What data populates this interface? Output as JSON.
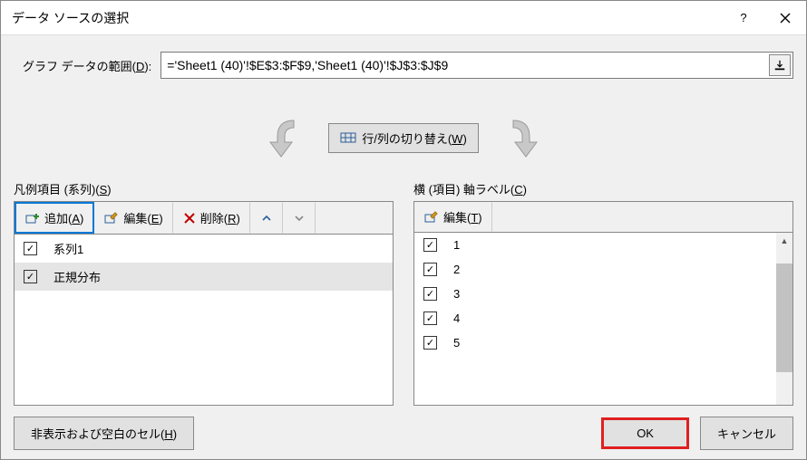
{
  "title": "データ ソースの選択",
  "range": {
    "label_pre": "グラフ データの範囲(",
    "label_key": "D",
    "label_post": "):",
    "value": "='Sheet1 (40)'!$E$3:$F$9,'Sheet1 (40)'!$J$3:$J$9"
  },
  "swap": {
    "label_pre": "行/列の切り替え(",
    "key": "W",
    "label_post": ")"
  },
  "legend": {
    "title_pre": "凡例項目 (系列)(",
    "key": "S",
    "title_post": ")",
    "add": {
      "pre": "追加(",
      "key": "A",
      "post": ")"
    },
    "edit": {
      "pre": "編集(",
      "key": "E",
      "post": ")"
    },
    "remove": {
      "pre": "削除(",
      "key": "R",
      "post": ")"
    },
    "items": [
      {
        "label": "系列1",
        "checked": true,
        "selected": false
      },
      {
        "label": "正規分布",
        "checked": true,
        "selected": true
      }
    ]
  },
  "axis": {
    "title_pre": "横 (項目) 軸ラベル(",
    "key": "C",
    "title_post": ")",
    "edit": {
      "pre": "編集(",
      "key": "T",
      "post": ")"
    },
    "items": [
      {
        "label": "1",
        "checked": true
      },
      {
        "label": "2",
        "checked": true
      },
      {
        "label": "3",
        "checked": true
      },
      {
        "label": "4",
        "checked": true
      },
      {
        "label": "5",
        "checked": true
      }
    ]
  },
  "footer": {
    "hidden": {
      "pre": "非表示および空白のセル(",
      "key": "H",
      "post": ")"
    },
    "ok": "OK",
    "cancel": "キャンセル"
  }
}
